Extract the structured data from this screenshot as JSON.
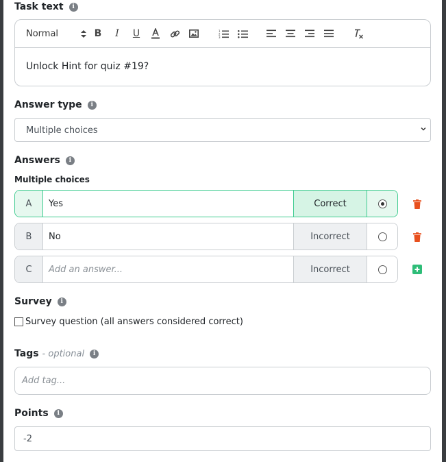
{
  "task_text": {
    "label": "Task text",
    "toolbar": {
      "format": "Normal"
    },
    "content": "Unlock Hint for quiz #19?"
  },
  "answer_type": {
    "label": "Answer type",
    "selected": "Multiple choices"
  },
  "answers": {
    "label": "Answers",
    "sublabel": "Multiple choices",
    "rows": [
      {
        "letter": "A",
        "text": "Yes",
        "status": "Correct",
        "selected": true
      },
      {
        "letter": "B",
        "text": "No",
        "status": "Incorrect",
        "selected": false
      },
      {
        "letter": "C",
        "text": "",
        "placeholder": "Add an answer...",
        "status": "Incorrect",
        "selected": false
      }
    ]
  },
  "survey": {
    "label": "Survey",
    "checkbox_label": "Survey question (all answers considered correct)",
    "checked": false
  },
  "tags": {
    "label": "Tags",
    "optional": "- optional",
    "placeholder": "Add tag..."
  },
  "points": {
    "label": "Points",
    "value": "-2"
  },
  "colors": {
    "accent_green": "#3ecb8f",
    "delete_red": "#e8501e",
    "add_green": "#2ebd78"
  },
  "icons": {
    "info": "info-icon",
    "delete": "trash-icon",
    "add": "plus-square-icon"
  }
}
